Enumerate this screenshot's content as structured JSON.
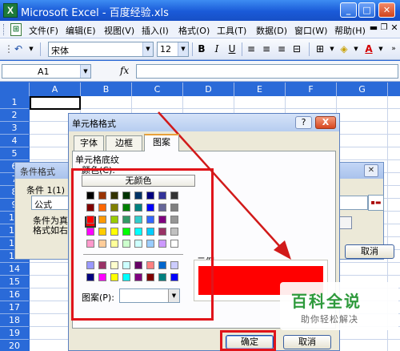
{
  "window": {
    "title": "Microsoft Excel - 百度经验.xls",
    "min_icon": "minimize-icon",
    "max_icon": "maximize-icon",
    "close_icon": "close-icon"
  },
  "menu": {
    "items": [
      "文件(F)",
      "编辑(E)",
      "视图(V)",
      "插入(I)",
      "格式(O)",
      "工具(T)",
      "数据(D)",
      "窗口(W)",
      "帮助(H)"
    ]
  },
  "toolbar": {
    "font_name": "宋体",
    "font_size": "12",
    "bold": "B",
    "italic": "I",
    "underline": "U",
    "font_color_label": "A"
  },
  "formula_bar": {
    "name_box": "A1",
    "fx": "fx",
    "formula": ""
  },
  "sheet": {
    "columns": [
      "A",
      "B",
      "C",
      "D",
      "E",
      "F",
      "G"
    ],
    "rows": [
      "1",
      "2",
      "3",
      "4",
      "5",
      "6",
      "7",
      "8",
      "9",
      "10",
      "11",
      "12",
      "13",
      "14",
      "15",
      "16",
      "17",
      "18",
      "19",
      "20"
    ]
  },
  "conditional_format_dialog": {
    "title": "条件格式",
    "condition_label": "条件 1(1)",
    "formula_option": "公式",
    "text_line1": "条件为真",
    "text_line2": "格式如右",
    "cancel": "取消"
  },
  "format_cells_dialog": {
    "title": "单元格格式",
    "help": "?",
    "close": "X",
    "tabs": [
      "字体",
      "边框",
      "图案"
    ],
    "active_tab": "图案",
    "shading_label": "单元格底纹",
    "color_label": "颜色(C):",
    "no_color": "无颜色",
    "sample_label": "示例",
    "pattern_label": "图案(P):",
    "ok": "确定",
    "cancel": "取消",
    "selected_color": "#ff0000",
    "palette": [
      [
        "#000000",
        "#993300",
        "#333300",
        "#003300",
        "#003366",
        "#000080",
        "#333399",
        "#333333"
      ],
      [
        "#800000",
        "#ff6600",
        "#808000",
        "#008000",
        "#008080",
        "#0000ff",
        "#666699",
        "#808080"
      ],
      [
        "#ff0000",
        "#ff9900",
        "#99cc00",
        "#339966",
        "#33cccc",
        "#3366ff",
        "#800080",
        "#969696"
      ],
      [
        "#ff00ff",
        "#ffcc00",
        "#ffff00",
        "#00ff00",
        "#00ffff",
        "#00ccff",
        "#993366",
        "#c0c0c0"
      ],
      [
        "#ff99cc",
        "#ffcc99",
        "#ffff99",
        "#ccffcc",
        "#ccffff",
        "#99ccff",
        "#cc99ff",
        "#ffffff"
      ]
    ],
    "palette_extra": [
      [
        "#9999ff",
        "#993366",
        "#ffffcc",
        "#ccffff",
        "#660066",
        "#ff8080",
        "#0066cc",
        "#ccccff"
      ],
      [
        "#000080",
        "#ff00ff",
        "#ffff00",
        "#00ffff",
        "#800080",
        "#800000",
        "#008080",
        "#0000ff"
      ]
    ]
  },
  "watermark": {
    "text": "百科全说",
    "sub": "助你轻松解决"
  },
  "annotation_color": "#e0141a"
}
